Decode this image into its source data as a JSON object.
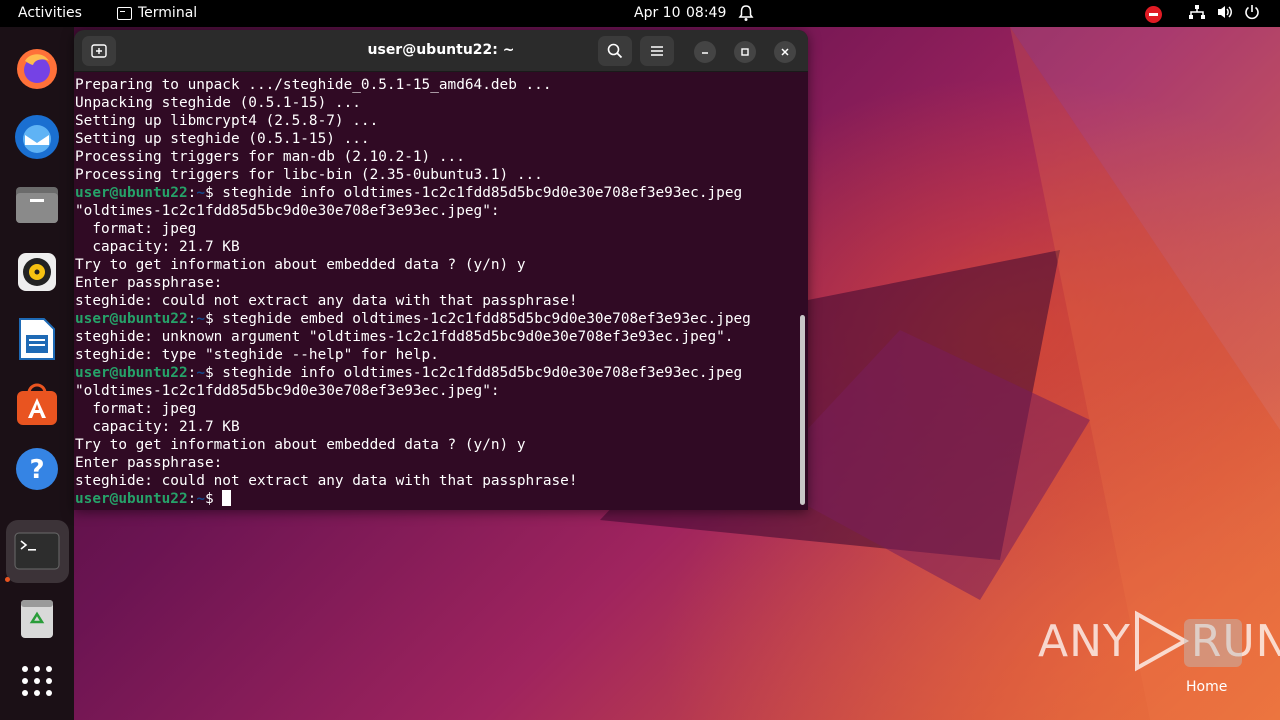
{
  "topbar": {
    "activities": "Activities",
    "app_name": "Terminal",
    "date": "Apr 10",
    "time": "08:49"
  },
  "dock": {
    "items": [
      "firefox-icon",
      "thunderbird-icon",
      "files-icon",
      "rhythmbox-icon",
      "writer-icon",
      "app-center-icon",
      "help-icon",
      "terminal-icon",
      "trash-icon",
      "show-apps-icon"
    ]
  },
  "terminal": {
    "title": "user@ubuntu22: ~",
    "prompt_user": "user@ubuntu22",
    "prompt_path": "~",
    "lines": [
      {
        "type": "out",
        "text": "Preparing to unpack .../steghide_0.5.1-15_amd64.deb ..."
      },
      {
        "type": "out",
        "text": "Unpacking steghide (0.5.1-15) ..."
      },
      {
        "type": "out",
        "text": "Setting up libmcrypt4 (2.5.8-7) ..."
      },
      {
        "type": "out",
        "text": "Setting up steghide (0.5.1-15) ..."
      },
      {
        "type": "out",
        "text": "Processing triggers for man-db (2.10.2-1) ..."
      },
      {
        "type": "out",
        "text": "Processing triggers for libc-bin (2.35-0ubuntu3.1) ..."
      },
      {
        "type": "cmd",
        "text": "steghide info oldtimes-1c2c1fdd85d5bc9d0e30e708ef3e93ec.jpeg"
      },
      {
        "type": "out",
        "text": "\"oldtimes-1c2c1fdd85d5bc9d0e30e708ef3e93ec.jpeg\":"
      },
      {
        "type": "out",
        "text": "  format: jpeg"
      },
      {
        "type": "out",
        "text": "  capacity: 21.7 KB"
      },
      {
        "type": "out",
        "text": "Try to get information about embedded data ? (y/n) y"
      },
      {
        "type": "out",
        "text": "Enter passphrase:"
      },
      {
        "type": "out",
        "text": "steghide: could not extract any data with that passphrase!"
      },
      {
        "type": "cmd",
        "text": "steghide embed oldtimes-1c2c1fdd85d5bc9d0e30e708ef3e93ec.jpeg"
      },
      {
        "type": "out",
        "text": "steghide: unknown argument \"oldtimes-1c2c1fdd85d5bc9d0e30e708ef3e93ec.jpeg\"."
      },
      {
        "type": "out",
        "text": "steghide: type \"steghide --help\" for help."
      },
      {
        "type": "cmd",
        "text": "steghide info oldtimes-1c2c1fdd85d5bc9d0e30e708ef3e93ec.jpeg"
      },
      {
        "type": "out",
        "text": "\"oldtimes-1c2c1fdd85d5bc9d0e30e708ef3e93ec.jpeg\":"
      },
      {
        "type": "out",
        "text": "  format: jpeg"
      },
      {
        "type": "out",
        "text": "  capacity: 21.7 KB"
      },
      {
        "type": "out",
        "text": "Try to get information about embedded data ? (y/n) y"
      },
      {
        "type": "out",
        "text": "Enter passphrase:"
      },
      {
        "type": "out",
        "text": "steghide: could not extract any data with that passphrase!"
      },
      {
        "type": "cmd",
        "text": ""
      }
    ]
  },
  "desktop": {
    "watermark": "ANY RUN",
    "home_label": "Home"
  },
  "colors": {
    "terminal_bg": "#300a24",
    "prompt_user": "#26a269",
    "prompt_path": "#12488b",
    "accent": "#e95420"
  }
}
